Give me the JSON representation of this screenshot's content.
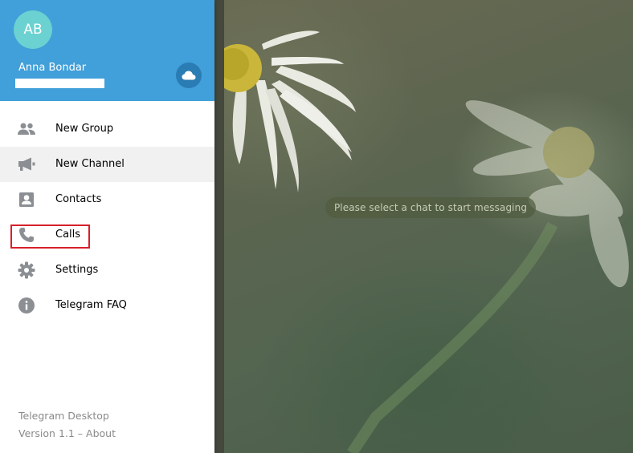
{
  "header": {
    "avatar_initials": "AB",
    "user_name": "Anna Bondar",
    "cloud_icon": "cloud-icon"
  },
  "menu": {
    "items": [
      {
        "label": "New Group",
        "icon": "group-icon"
      },
      {
        "label": "New Channel",
        "icon": "megaphone-icon"
      },
      {
        "label": "Contacts",
        "icon": "contact-card-icon"
      },
      {
        "label": "Calls",
        "icon": "phone-icon"
      },
      {
        "label": "Settings",
        "icon": "gear-icon"
      },
      {
        "label": "Telegram FAQ",
        "icon": "info-icon"
      }
    ]
  },
  "footer": {
    "app_name": "Telegram Desktop",
    "version_text": "Version 1.1 – About"
  },
  "chat": {
    "empty_message": "Please select a chat to start messaging"
  },
  "colors": {
    "header_blue": "#419fd9",
    "avatar": "#6bd1d1",
    "highlight": "#d8202a"
  }
}
